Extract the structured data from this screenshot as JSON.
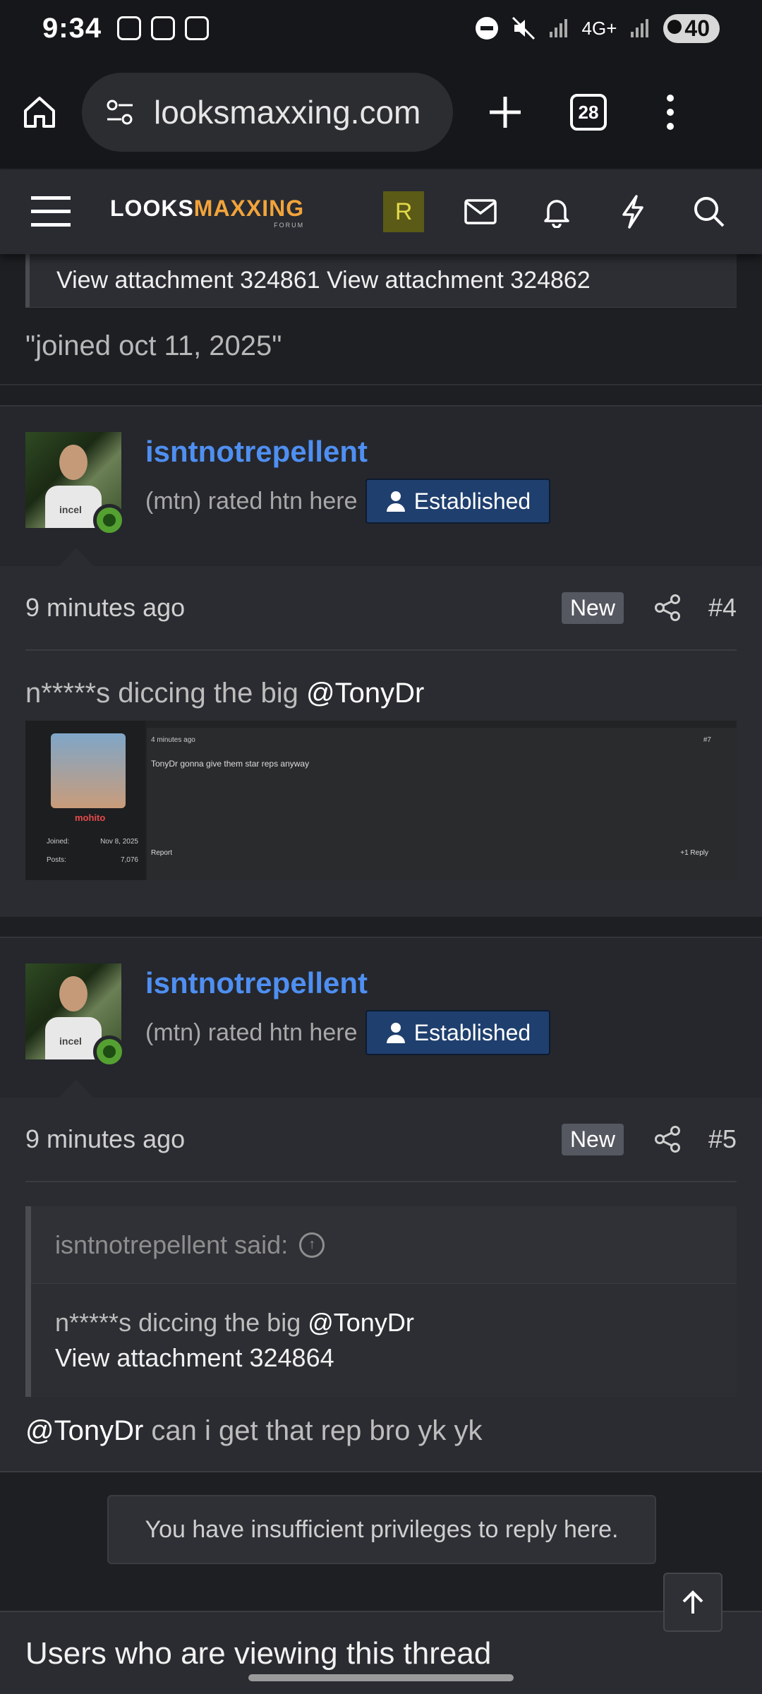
{
  "statusbar": {
    "time": "9:34",
    "network": "4G+",
    "battery": "40"
  },
  "browser": {
    "url": "looksmaxxing.com",
    "tab_count": "28"
  },
  "forum": {
    "logo_main_left": "LOOKS",
    "logo_main_right": "MAXXING",
    "logo_sub": "FORUM",
    "user_initial": "R"
  },
  "prev_post": {
    "quote_tail": "View attachment 324861 View attachment 324862",
    "text": "\"joined oct 11, 2025\""
  },
  "posts": [
    {
      "username": "isntnotrepellent",
      "user_title": "(mtn) rated htn here",
      "badge": "Established",
      "time": "9 minutes ago",
      "new_label": "New",
      "number": "#4",
      "message": "n*****s diccing the big ",
      "mention": "@TonyDr",
      "attachment": {
        "member": "mohito",
        "joined_label": "Joined:",
        "joined_value": "Nov 8, 2025",
        "posts_label": "Posts:",
        "posts_value": "7,076",
        "time": "4 minutes ago",
        "text": "TonyDr gonna give them star reps anyway",
        "report": "Report",
        "like": "+1",
        "reply": "Reply",
        "number": "#7"
      }
    },
    {
      "username": "isntnotrepellent",
      "user_title": "(mtn) rated htn here",
      "badge": "Established",
      "time": "9 minutes ago",
      "new_label": "New",
      "number": "#5",
      "quote_author": "isntnotrepellent said:",
      "quote_text": "n*****s diccing the big ",
      "quote_mention": "@TonyDr",
      "quote_attachment": "View attachment 324864",
      "reply_mention": "@TonyDr",
      "reply_text": " can i get that rep bro yk yk"
    }
  ],
  "notice": "You have insufficient privileges to reply here.",
  "viewers_heading": "Users who are viewing this thread"
}
